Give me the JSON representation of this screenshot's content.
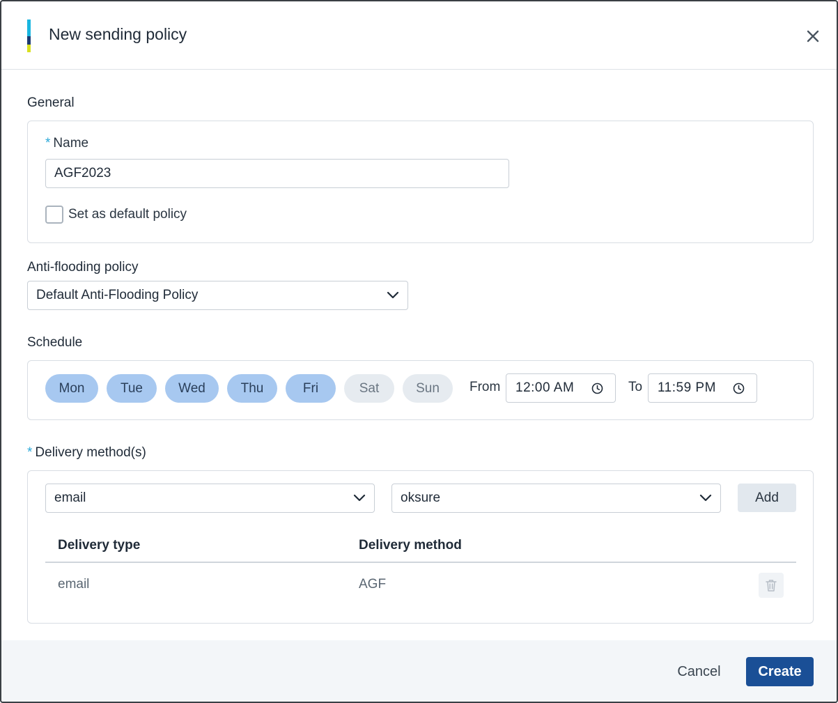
{
  "dialog": {
    "title": "New sending policy",
    "close_icon": "close-icon"
  },
  "general": {
    "section_label": "General",
    "name_required": "*",
    "name_label": "Name",
    "name_value": "AGF2023",
    "default_checkbox_label": "Set as default policy",
    "default_checked": false
  },
  "anti_flooding": {
    "section_label": "Anti-flooding policy",
    "selected": "Default Anti-Flooding Policy"
  },
  "schedule": {
    "section_label": "Schedule",
    "days": [
      {
        "label": "Mon",
        "selected": true
      },
      {
        "label": "Tue",
        "selected": true
      },
      {
        "label": "Wed",
        "selected": true
      },
      {
        "label": "Thu",
        "selected": true
      },
      {
        "label": "Fri",
        "selected": true
      },
      {
        "label": "Sat",
        "selected": false
      },
      {
        "label": "Sun",
        "selected": false
      }
    ],
    "from_label": "From",
    "from_value": "12:00 AM",
    "to_label": "To",
    "to_value": "11:59 PM"
  },
  "delivery": {
    "required": "*",
    "section_label": "Delivery method(s)",
    "type_select": "email",
    "method_select": "oksure",
    "add_label": "Add",
    "columns": [
      "Delivery type",
      "Delivery method"
    ],
    "rows": [
      {
        "type": "email",
        "method": "AGF"
      }
    ]
  },
  "footer": {
    "cancel_label": "Cancel",
    "create_label": "Create"
  },
  "colors": {
    "primary": "#1a4f96",
    "day_selected": "#a7c8f0",
    "day_unselected": "#e6ebf0",
    "required": "#2aa8d8"
  }
}
